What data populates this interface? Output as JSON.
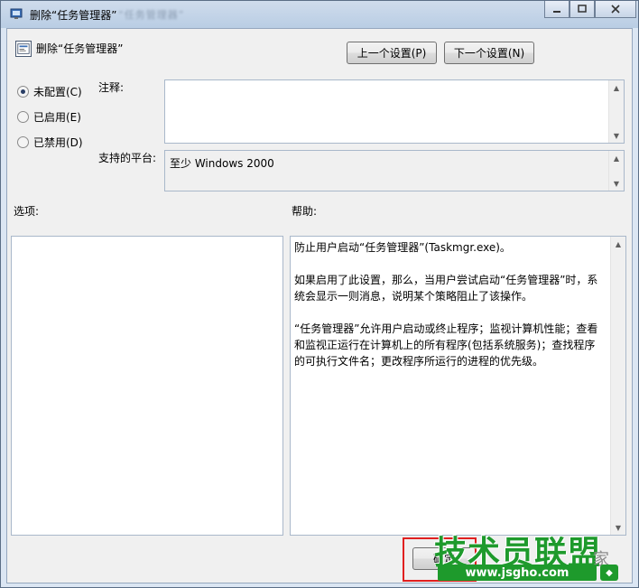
{
  "window": {
    "title": "删除“任务管理器”",
    "title_suffix_blurred": "“任务管理器”",
    "caption_buttons": {
      "minimize_icon": "minimize-icon",
      "maximize_icon": "maximize-icon",
      "close_icon": "close-icon"
    }
  },
  "header": {
    "icon": "policy-setting-icon",
    "title": "删除“任务管理器”",
    "prev_button": "上一个设置(P)",
    "next_button": "下一个设置(N)"
  },
  "state_options": [
    {
      "label": "未配置(C)",
      "checked": true
    },
    {
      "label": "已启用(E)",
      "checked": false
    },
    {
      "label": "已禁用(D)",
      "checked": false
    }
  ],
  "comment": {
    "label": "注释:",
    "value": ""
  },
  "platform": {
    "label": "支持的平台:",
    "value": "至少 Windows 2000"
  },
  "options": {
    "label": "选项:"
  },
  "help": {
    "label": "帮助:",
    "paragraphs": [
      "防止用户启动“任务管理器”(Taskmgr.exe)。",
      "如果启用了此设置，那么，当用户尝试启动“任务管理器”时，系统会显示一则消息，说明某个策略阻止了该操作。",
      "“任务管理器”允许用户启动或终止程序；监视计算机性能；查看和监视正运行在计算机上的所有程序(包括系统服务)；查找程序的可执行文件名；更改程序所运行的进程的优先级。"
    ]
  },
  "footer": {
    "ok_button": "确定"
  },
  "watermark": {
    "main": "技术员联盟",
    "url": "www.jsgho.com",
    "side": "家"
  },
  "colors": {
    "highlight": "#e02020",
    "watermark": "#1e9a2c"
  }
}
